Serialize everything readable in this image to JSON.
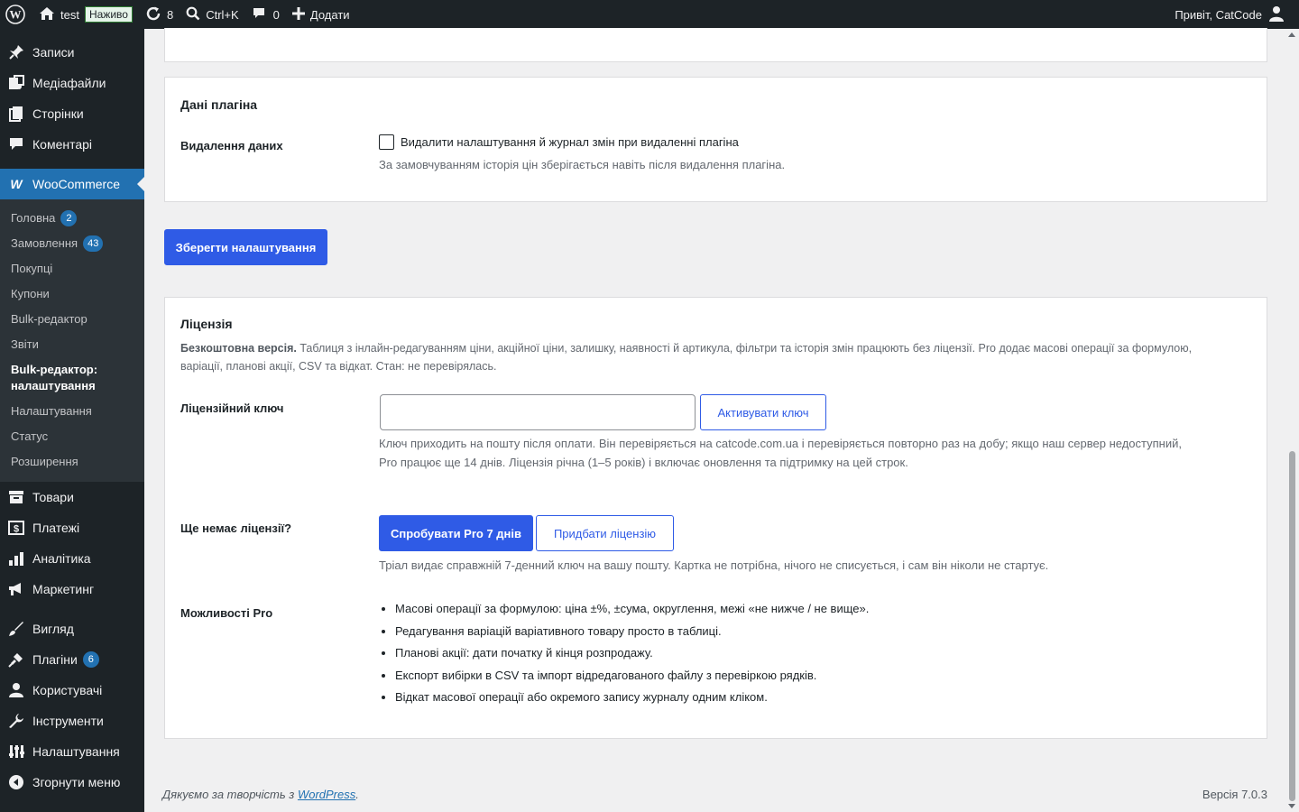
{
  "adminbar": {
    "site_name": "test",
    "live_badge": "Наживо",
    "updates_count": "8",
    "search_shortcut": "Ctrl+K",
    "comments_count": "0",
    "add_new": "Додати",
    "greeting": "Привіт, CatCode"
  },
  "sidebar": {
    "top_items": [
      {
        "label": "Записи",
        "icon": "pin-icon"
      },
      {
        "label": "Медіафайли",
        "icon": "media-icon"
      },
      {
        "label": "Сторінки",
        "icon": "pages-icon"
      },
      {
        "label": "Коментарі",
        "icon": "comment-icon"
      }
    ],
    "woocommerce": "WooCommerce",
    "submenu": [
      {
        "label": "Головна",
        "count": "2"
      },
      {
        "label": "Замовлення",
        "count": "43"
      },
      {
        "label": "Покупці"
      },
      {
        "label": "Купони"
      },
      {
        "label": "Bulk-редактор"
      },
      {
        "label": "Звіти"
      },
      {
        "label": "Bulk-редактор: налаштування",
        "active": true
      },
      {
        "label": "Налаштування"
      },
      {
        "label": "Статус"
      },
      {
        "label": "Розширення"
      }
    ],
    "mid_items": [
      {
        "label": "Товари",
        "icon": "archive-icon"
      },
      {
        "label": "Платежі",
        "icon": "payments-icon"
      },
      {
        "label": "Аналітика",
        "icon": "analytics-icon"
      },
      {
        "label": "Маркетинг",
        "icon": "megaphone-icon"
      }
    ],
    "bottom_items": [
      {
        "label": "Вигляд",
        "icon": "brush-icon"
      },
      {
        "label": "Плагіни",
        "icon": "plugin-icon",
        "count": "6"
      },
      {
        "label": "Користувачі",
        "icon": "users-icon"
      },
      {
        "label": "Інструменти",
        "icon": "wrench-icon"
      },
      {
        "label": "Налаштування",
        "icon": "settings-icon"
      },
      {
        "label": "Згорнути меню",
        "icon": "collapse-icon"
      }
    ]
  },
  "plugin_data": {
    "title": "Дані плагіна",
    "row_label": "Видалення даних",
    "checkbox_label": "Видалити налаштування й журнал змін при видаленні плагіна",
    "description": "За замовчуванням історія цін зберігається навіть після видалення плагіна."
  },
  "save_button": "Зберегти налаштування",
  "license": {
    "title": "Ліцензія",
    "intro_bold": "Безкоштовна версія.",
    "intro_line1": " Таблиця з інлайн-редагуванням ціни, акційної ціни, залишку, наявності й артикула, фільтри та історія змін працюють без ліцензії. Pro додає масові операції за формулою,",
    "intro_line2": "варіації, планові акції, CSV та відкат. Стан: не перевірялась.",
    "key_label": "Ліцензійний ключ",
    "key_value": "",
    "activate_button": "Активувати ключ",
    "key_desc_line1": "Ключ приходить на пошту після оплати. Він перевіряється на catcode.com.ua і перевіряється повторно раз на добу; якщо наш сервер недоступний,",
    "key_desc_line2": "Pro працює ще 14 днів. Ліцензія річна (1–5 років) і включає оновлення та підтримку на цей строк.",
    "no_license_label": "Ще немає ліцензії?",
    "trial_button": "Спробувати Pro 7 днів",
    "buy_button": "Придбати ліцензію",
    "trial_desc": "Тріал видає справжній 7-денний ключ на вашу пошту. Картка не потрібна, нічого не списується, і сам він ніколи не стартує.",
    "pro_label": "Можливості Pro",
    "pro_features": [
      "Масові операції за формулою: ціна ±%, ±сума, округлення, межі «не нижче / не вище».",
      "Редагування варіацій варіативного товару просто в таблиці.",
      "Планові акції: дати початку й кінця розпродажу.",
      "Експорт вибірки в CSV та імпорт відредагованого файлу з перевіркою рядків.",
      "Відкат масової операції або окремого запису журналу одним кліком."
    ]
  },
  "footer": {
    "thanks_prefix": "Дякуємо за творчість з ",
    "wordpress_link": "WordPress",
    "thanks_suffix": ".",
    "version": "Версія 7.0.3"
  },
  "colors": {
    "primary": "#2f5be6",
    "admin_dark": "#1d2327",
    "wp_blue": "#2271b1"
  }
}
